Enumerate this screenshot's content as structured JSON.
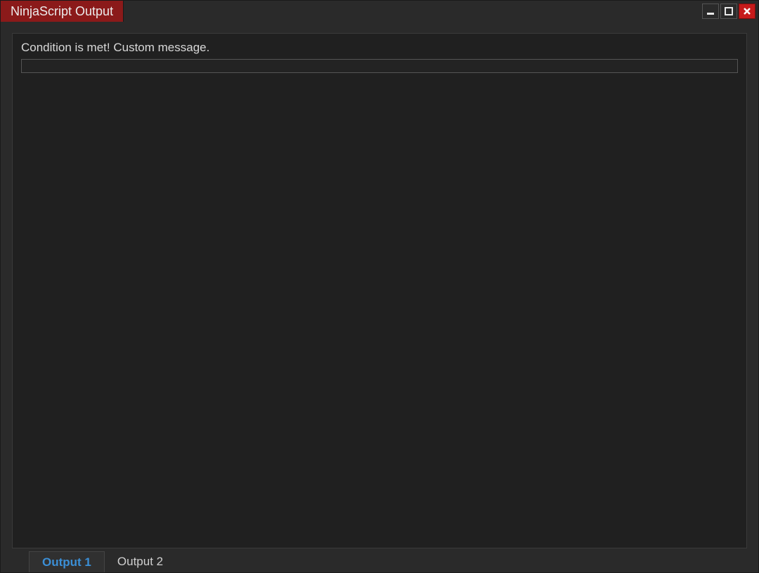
{
  "window": {
    "title": "NinjaScript Output"
  },
  "output": {
    "message": "Condition is met! Custom message.",
    "input_value": ""
  },
  "tabs": [
    {
      "label": "Output 1",
      "active": true
    },
    {
      "label": "Output 2",
      "active": false
    }
  ]
}
